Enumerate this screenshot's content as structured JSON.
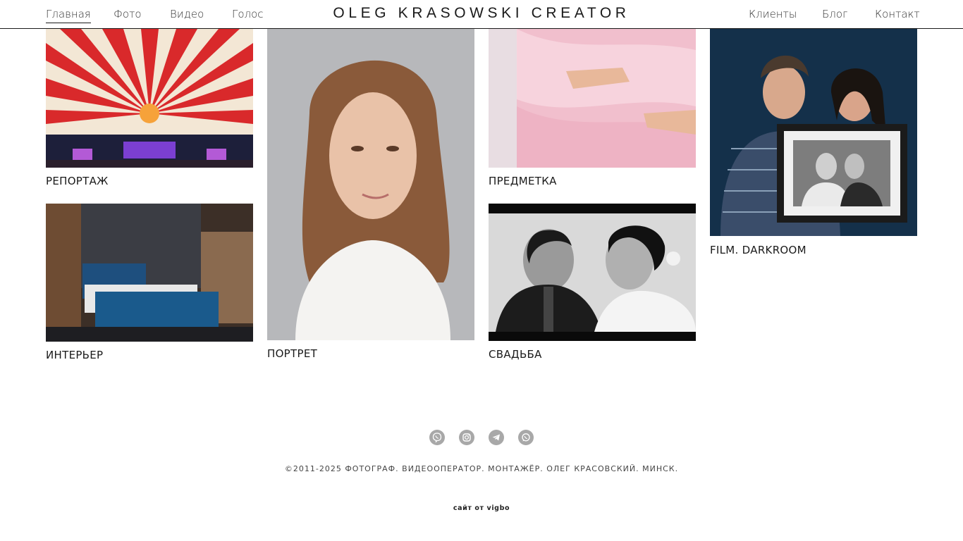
{
  "header": {
    "brand": "OLEG KRASOWSKI CREATOR",
    "nav_left": [
      "Главная",
      "Фото",
      "Видео",
      "Голос"
    ],
    "nav_right": [
      "Клиенты",
      "Блог",
      "Контакт"
    ]
  },
  "gallery": [
    {
      "caption": "РЕПОРТАЖ"
    },
    {
      "caption": "ИНТЕРЬЕР"
    },
    {
      "caption": "ПОРТРЕТ"
    },
    {
      "caption": "ПРЕДМЕТКА"
    },
    {
      "caption": "СВАДЬБА"
    },
    {
      "caption": "FILM. DARKROOM"
    }
  ],
  "footer": {
    "social_icons": [
      "viber-icon",
      "instagram-icon",
      "telegram-icon",
      "whatsapp-icon"
    ],
    "copyright": "©2011-2025 ФОТОГРАФ. ВИДЕООПЕРАТОР. МОНТАЖЁР. ОЛЕГ КРАСОВСКИЙ. МИНСК.",
    "credit": "сайт от vigbo"
  },
  "colors": {
    "text": "#1a1a1a",
    "icon_gray": "#a8a8a8",
    "background": "#ffffff"
  }
}
